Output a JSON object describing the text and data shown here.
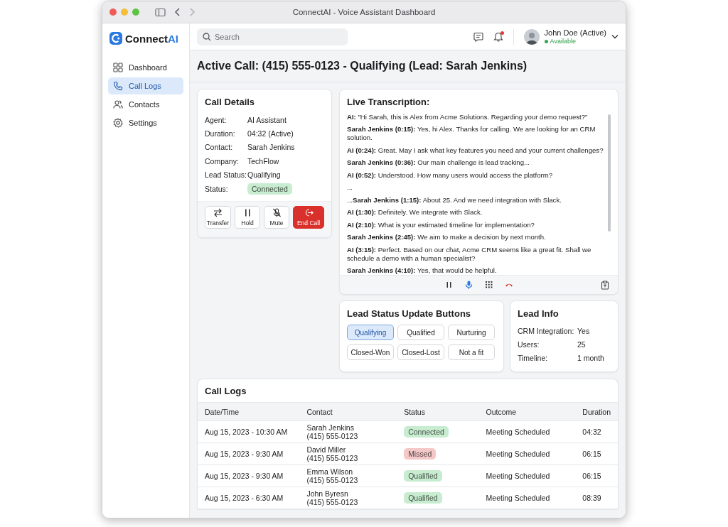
{
  "window": {
    "title": "ConnectAI - Voice Assistant Dashboard"
  },
  "sidebar": {
    "logo": {
      "name": "Connect",
      "accent": "AI"
    },
    "items": [
      {
        "label": "Dashboard",
        "selected": false
      },
      {
        "label": "Call Logs",
        "selected": true
      },
      {
        "label": "Contacts",
        "selected": false
      },
      {
        "label": "Settings",
        "selected": false
      }
    ]
  },
  "topbar": {
    "search": {
      "placeholder": "Search"
    },
    "notifications": {
      "unread": true
    },
    "user": {
      "name": "John Doe (Active)",
      "status": "Available",
      "online": true
    }
  },
  "heading": "Active Call: (415) 555-0123 - Qualifying (Lead: Sarah Jenkins)",
  "call_details": {
    "title": "Call Details",
    "fields": [
      {
        "label": "Agent:",
        "value": "AI Assistant",
        "kind": "text"
      },
      {
        "label": "Duration:",
        "value": "04:32 (Active)",
        "kind": "text"
      },
      {
        "label": "Contact:",
        "value": "Sarah Jenkins",
        "kind": "text"
      },
      {
        "label": "Company:",
        "value": "TechFlow",
        "kind": "text"
      },
      {
        "label": "Lead Status:",
        "value": "Qualifying",
        "kind": "text"
      },
      {
        "label": "Status:",
        "value": "Connected",
        "kind": "badge",
        "color": "#c8ecd0"
      }
    ],
    "actions": [
      {
        "label": "Transfer",
        "kind": "normal"
      },
      {
        "label": "Hold",
        "kind": "normal"
      },
      {
        "label": "Mute",
        "kind": "normal"
      },
      {
        "label": "End Call",
        "kind": "danger"
      }
    ]
  },
  "transcription": {
    "title": "Live Transcription:",
    "lines": [
      "**AI:** \"Hi Sarah, this is Alex from Acme Solutions. Regarding your demo request?\"",
      "**Sarah Jenkins (0:15):** Yes, hi Alex. Thanks for calling. We are looking for an CRM solution.",
      "**AI (0:24):** Great. May I ask what key features you need and your current challenges?",
      "**Sarah Jenkins (0:36):** Our main challenge is lead tracking...",
      "**AI (0:52):** Understood. How many users would access the platform?",
      "...",
      "...**Sarah Jenkins (1:15):** About 25. And we need integration with Slack.",
      "**AI (1:30):** Definitely. We integrate with Slack.",
      "**AI (2:10):** What is your estimated timeline for implementation?",
      "**Sarah Jenkins (2:45):** We aim to make a decision by next month.",
      "**AI (3:15):** Perfect. Based on our chat, Acme CRM seems like a great fit. Shall we schedule a demo with a human specialist?",
      "**Sarah Jenkins (4:10):** Yes, that would be helpful."
    ]
  },
  "lead_status": {
    "title": "Lead Status Update Buttons",
    "options": [
      {
        "label": "Qualifying",
        "selected": true
      },
      {
        "label": "Qualified",
        "selected": false
      },
      {
        "label": "Nurturing",
        "selected": false
      },
      {
        "label": "Closed-Won",
        "selected": false
      },
      {
        "label": "Closed-Lost",
        "selected": false
      },
      {
        "label": "Not a fit",
        "selected": false
      }
    ]
  },
  "lead_info": {
    "title": "Lead Info",
    "fields": [
      {
        "label": "CRM Integration:",
        "value": "Yes"
      },
      {
        "label": "Users:",
        "value": "25"
      },
      {
        "label": "Timeline:",
        "value": "1 month"
      }
    ]
  },
  "call_logs": {
    "title": "Call Logs",
    "columns": [
      "Date/Time",
      "Contact",
      "Status",
      "Outcome",
      "Duration"
    ],
    "rows": [
      {
        "datetime": "Aug 15, 2023 - 10:30 AM",
        "contact": "Sarah Jenkins",
        "phone": "(415) 555-0123",
        "status": "Connected",
        "color": "#c8ecd0",
        "outcome": "Meeting Scheduled",
        "duration": "04:32"
      },
      {
        "datetime": "Aug 15, 2023 - 9:30 AM",
        "contact": "David Miller",
        "phone": "(415) 555-0123",
        "status": "Missed",
        "color": "#f5c8c8",
        "outcome": "Meeting Scheduled",
        "duration": "06:15"
      },
      {
        "datetime": "Aug 15, 2023 - 9:30 AM",
        "contact": "Emma Wilson",
        "phone": "(415) 555-0123",
        "status": "Qualified",
        "color": "#c8ecd0",
        "outcome": "Meeting Scheduled",
        "duration": "06:15"
      },
      {
        "datetime": "Aug 15, 2023 - 6:30 AM",
        "contact": "John Byresn",
        "phone": "(415) 555-0123",
        "status": "Qualified",
        "color": "#c8ecd0",
        "outcome": "Meeting Scheduled",
        "duration": "08:39"
      }
    ]
  }
}
